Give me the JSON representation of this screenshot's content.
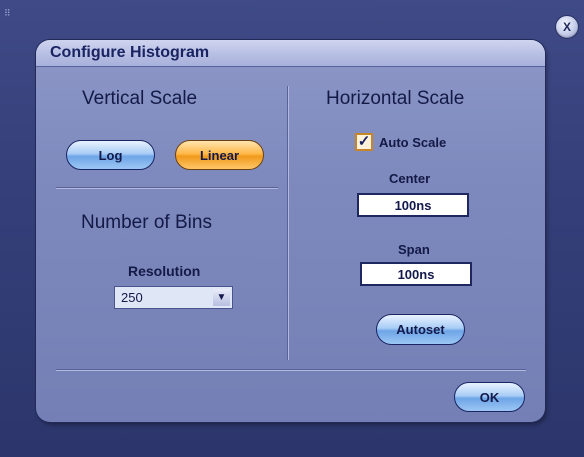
{
  "dialog": {
    "title": "Configure Histogram",
    "close_label": "X",
    "ok_label": "OK"
  },
  "vertical_scale": {
    "heading": "Vertical Scale",
    "log_label": "Log",
    "linear_label": "Linear",
    "selected": "Linear"
  },
  "bins": {
    "heading": "Number of Bins",
    "resolution_label": "Resolution",
    "resolution_value": "250",
    "dropdown_arrow": "▼"
  },
  "horizontal_scale": {
    "heading": "Horizontal Scale",
    "auto_scale_label": "Auto Scale",
    "auto_scale_checked": true,
    "checkmark": "✓",
    "center_label": "Center",
    "center_value": "100ns",
    "span_label": "Span",
    "span_value": "100ns",
    "autoset_label": "Autoset"
  },
  "colors": {
    "selected_button": "#f09a1c",
    "unselected_button": "#6ea5e6",
    "dialog_background": "#7e89bd",
    "title_text": "#1b2463"
  }
}
